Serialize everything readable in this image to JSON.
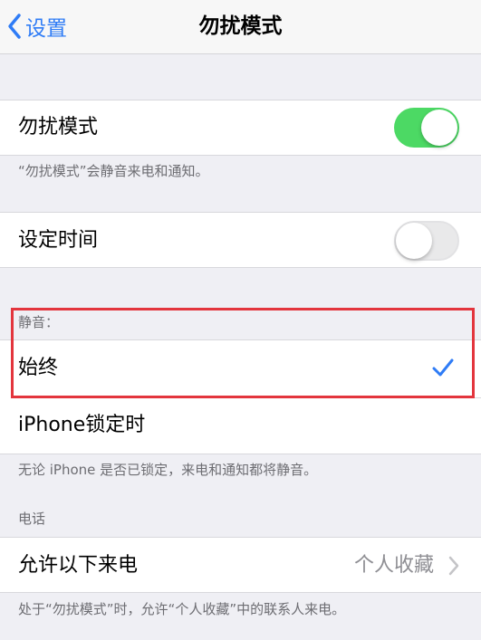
{
  "nav": {
    "back_label": "设置",
    "title": "勿扰模式"
  },
  "dnd": {
    "label": "勿扰模式",
    "enabled": true,
    "footer": "“勿扰模式”会静音来电和通知。"
  },
  "schedule": {
    "label": "设定时间",
    "enabled": false
  },
  "silence": {
    "header": "静音：",
    "options": [
      {
        "label": "始终",
        "selected": true
      },
      {
        "label": "iPhone锁定时",
        "selected": false
      }
    ],
    "footer": "无论 iPhone 是否已锁定，来电和通知都将静音。"
  },
  "phone": {
    "header": "电话",
    "allow_calls": {
      "label": "允许以下来电",
      "value": "个人收藏"
    },
    "footer": "处于“勿扰模式”时，允许“个人收藏”中的联系人来电。"
  },
  "colors": {
    "accent": "#2f7cf6",
    "toggle_on": "#4cd964",
    "highlight": "#e3353d"
  },
  "icons": {
    "back": "chevron-left-icon",
    "check": "checkmark-icon",
    "disclosure": "chevron-right-icon"
  }
}
